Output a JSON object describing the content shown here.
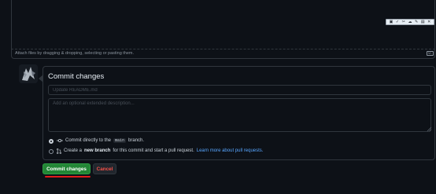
{
  "editor": {
    "attach_text": "Attach files by dragging & dropping, selecting or pasting them.",
    "markdown_icon": "markdown-icon",
    "toolbar_icons": [
      "image-icon",
      "checkmark-icon",
      "scissors-icon",
      "cloud-icon",
      "pencil-icon",
      "clipboard-icon",
      "close-icon"
    ]
  },
  "avatar": {
    "icon": "avatar-icon"
  },
  "commit": {
    "title": "Commit changes",
    "summary_placeholder": "Update README.md",
    "description_placeholder": "Add an optional extended description...",
    "option_direct": {
      "prefix": "Commit directly to the",
      "branch": "main",
      "suffix": "branch."
    },
    "option_new_branch": {
      "prefix": "Create a",
      "bold": "new branch",
      "middle": "for this commit and start a pull request.",
      "link": "Learn more about pull requests."
    },
    "selected_option": "direct"
  },
  "buttons": {
    "commit": "Commit changes",
    "cancel": "Cancel"
  },
  "colors": {
    "background": "#0d1117",
    "border": "#30363d",
    "primary_button": "#238636",
    "cancel_text": "#f85149",
    "link": "#58a6ff",
    "highlight_underline": "#e01b1b"
  }
}
